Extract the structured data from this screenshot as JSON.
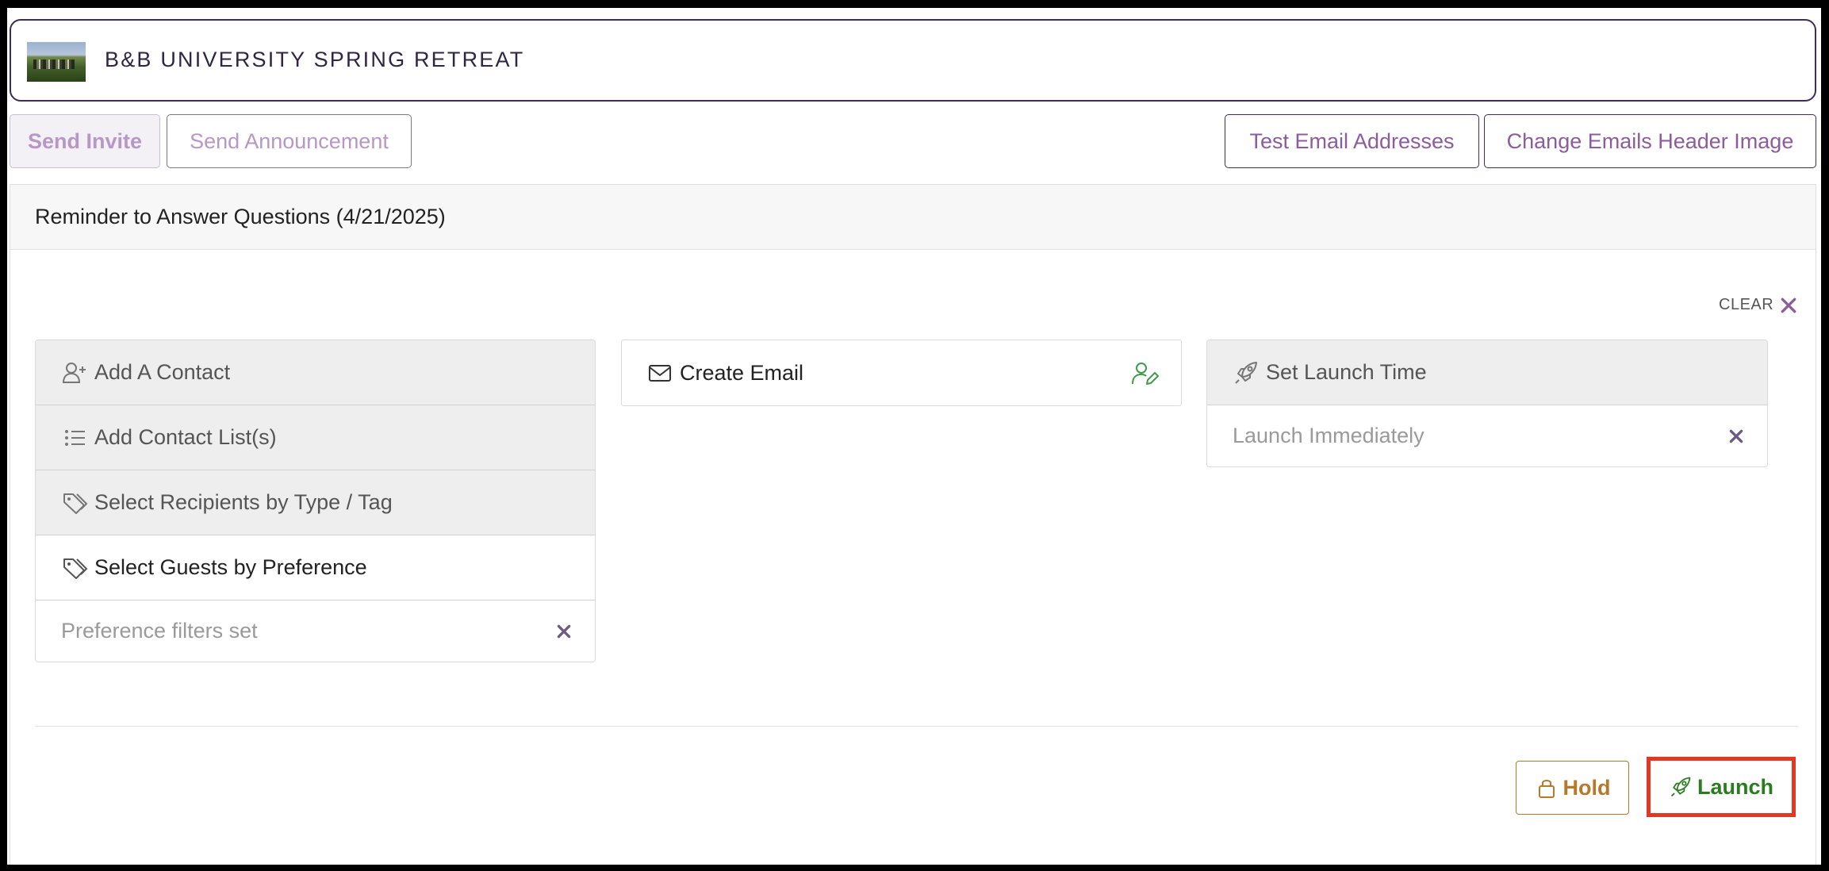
{
  "header": {
    "title": "B&B UNIVERSITY SPRING RETREAT"
  },
  "toolbar": {
    "send_invite": "Send Invite",
    "send_announcement": "Send Announcement",
    "test_email_addresses": "Test Email Addresses",
    "change_emails_header_image": "Change Emails Header Image"
  },
  "panel": {
    "title": "Reminder to Answer Questions (4/21/2025)",
    "clear_label": "CLEAR"
  },
  "recipients": {
    "add_contact": "Add A Contact",
    "add_contact_lists": "Add Contact List(s)",
    "select_by_type_tag": "Select Recipients by Type / Tag",
    "select_by_preference": "Select Guests by Preference",
    "preference_value": "Preference filters set"
  },
  "email": {
    "create_email": "Create Email"
  },
  "launch_time": {
    "label": "Set Launch Time",
    "value": "Launch Immediately"
  },
  "actions": {
    "hold": "Hold",
    "launch": "Launch"
  },
  "colors": {
    "accent_purple": "#8d5c9c",
    "border_dark": "#3d2e55",
    "hold": "#b7782a",
    "launch": "#2a7d1e",
    "launch_highlight": "#e03a26",
    "create_email_icon": "#3f9a4a"
  },
  "icons": {
    "add_contact": "user-plus-icon",
    "contact_lists": "list-icon",
    "tags": "tags-icon",
    "email": "envelope-icon",
    "edit_user": "user-edit-icon",
    "rocket": "rocket-icon",
    "close": "close-icon",
    "lock": "lock-icon"
  }
}
